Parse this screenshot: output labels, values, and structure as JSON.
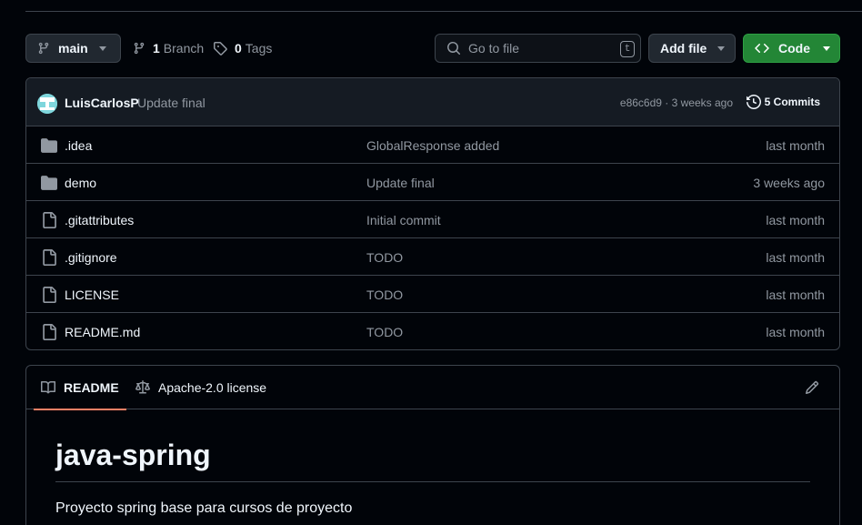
{
  "toolbar": {
    "branch_name": "main",
    "branch_count": "1",
    "branch_label": "Branch",
    "tag_count": "0",
    "tag_label": "Tags",
    "search_placeholder": "Go to file",
    "search_shortcut": "t",
    "add_file_label": "Add file",
    "code_label": "Code"
  },
  "commit": {
    "author": "LuisCarlosP",
    "message": "Update final",
    "hash_time": "e86c6d9 · 3 weeks ago",
    "commit_count": "5 Commits"
  },
  "files": [
    {
      "name": ".idea",
      "type": "folder",
      "message": "GlobalResponse added",
      "date": "last month"
    },
    {
      "name": "demo",
      "type": "folder",
      "message": "Update final",
      "date": "3 weeks ago"
    },
    {
      "name": ".gitattributes",
      "type": "file",
      "message": "Initial commit",
      "date": "last month"
    },
    {
      "name": ".gitignore",
      "type": "file",
      "message": "TODO",
      "date": "last month"
    },
    {
      "name": "LICENSE",
      "type": "file",
      "message": "TODO",
      "date": "last month"
    },
    {
      "name": "README.md",
      "type": "file",
      "message": "TODO",
      "date": "last month"
    }
  ],
  "readme": {
    "tab_readme": "README",
    "tab_license": "Apache-2.0 license",
    "title": "java-spring",
    "description": "Proyecto spring base para cursos de proyecto"
  },
  "colors": {
    "background": "#010409",
    "border": "#3d444d",
    "code_button": "#238636",
    "active_tab_underline": "#f78166"
  }
}
